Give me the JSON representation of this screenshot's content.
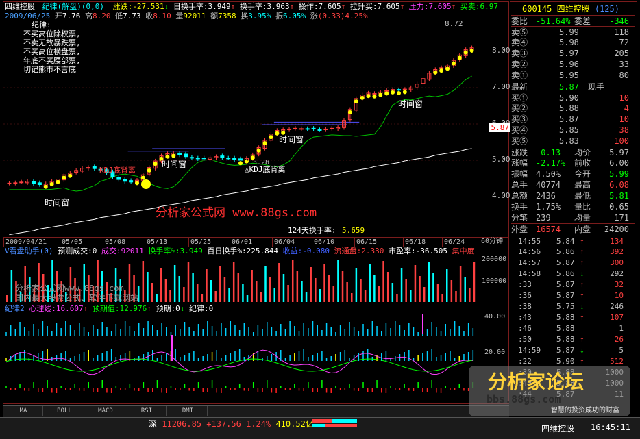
{
  "chart_header": {
    "stock_name": "四维控股",
    "indicator": "纪律(解盘)(0,0)",
    "stats": [
      {
        "label": "涨跌:",
        "value": "-27.531",
        "arrow": "↓",
        "color": "#ffff00"
      },
      {
        "label": "日换手率:",
        "value": "3.949",
        "arrow": "↑",
        "color": "#ffffff"
      },
      {
        "label": "换手率:",
        "value": "3.963",
        "arrow": "↑",
        "color": "#ffffff"
      },
      {
        "label": "操作:",
        "value": "7.605",
        "arrow": "↑",
        "color": "#ffffff"
      },
      {
        "label": "拉升买:",
        "value": "7.605",
        "arrow": "↑",
        "color": "#ffffff"
      },
      {
        "label": "压力:",
        "value": "7.605",
        "arrow": "↑",
        "color": "#ff40ff"
      },
      {
        "label": "买卖:",
        "value": "6.97",
        "arrow": "",
        "color": "#00ff00"
      }
    ],
    "bar_info": {
      "date": "2009/06/25",
      "open_label": "开",
      "open": "7.76",
      "high_label": "高",
      "high": "8.20",
      "low_label": "低",
      "low": "7.73",
      "close_label": "收",
      "close": "8.10",
      "vol_label": "量",
      "vol": "92011",
      "amount_label": "额",
      "amount": "7358",
      "turnover_label": "换",
      "turnover": "3.95%",
      "amplitude_label": "振",
      "amplitude": "6.05%",
      "change_label": "涨",
      "change": "(0.33)4.25%"
    }
  },
  "notes": {
    "lines": [
      "纪律:",
      "不买高位除权票,",
      "不卖无故暴跌票,",
      "不买高位横盘票,",
      "年底不买腰部票,",
      "切记熊市不言底"
    ]
  },
  "annotations": {
    "max_price": "8.72",
    "kdj_low": "3.28",
    "time_windows": [
      "时间窗",
      "时间窗",
      "时间窗",
      "时间窗"
    ],
    "kdj_divergence_left": "KDJ底背离",
    "kdj_divergence_right": "△KDJ底背离",
    "watermark": "分析家公式网 www.88gs.com",
    "turnover_124_label": "124天换手率:",
    "turnover_124_value": "5.659"
  },
  "chart_data": {
    "type": "candlestick",
    "price_axis_ticks": [
      "8.00",
      "7.00",
      "6.00",
      "5.00",
      "4.00"
    ],
    "current_price_tag": "5.87",
    "date_ticks": [
      "2009/04/21",
      "05/05",
      "05/08",
      "05/13",
      "05/25",
      "06/01",
      "06/04",
      "06/10",
      "06/15",
      "06/18",
      "06/24"
    ],
    "closes": [
      4.37,
      4.38,
      4.4,
      4.42,
      4.36,
      4.33,
      4.35,
      4.42,
      4.48,
      4.6,
      4.65,
      4.72,
      4.78,
      4.8,
      4.77,
      4.74,
      4.66,
      4.55,
      4.47,
      4.42,
      4.4,
      4.45,
      4.6,
      4.8,
      4.98,
      5.12,
      5.18,
      5.2,
      5.15,
      5.1,
      5.06,
      5.04,
      5.05,
      5.07,
      5.1,
      5.08,
      5.06,
      5.02,
      5.0,
      5.05,
      5.15,
      5.35,
      5.55,
      5.72,
      5.82,
      5.84,
      5.86,
      5.88,
      5.87,
      5.86,
      5.86,
      5.84,
      5.86,
      5.88,
      5.9,
      6.1,
      6.4,
      6.7,
      6.8,
      6.85,
      6.84,
      6.88,
      6.92,
      6.95,
      6.93,
      6.96,
      7.0,
      7.1,
      7.25,
      7.4,
      7.5,
      7.55,
      7.6,
      7.75,
      7.9,
      8.05,
      8.1
    ],
    "window_label": "60分钟"
  },
  "volume_panel": {
    "title": "V看盘助手(0)",
    "stats": [
      {
        "label": "预测成交:",
        "value": "0",
        "color": "#ffffff"
      },
      {
        "label": "成交:",
        "value": "92011",
        "color": "#ff40ff"
      },
      {
        "label": "换手率%:",
        "value": "3.949",
        "color": "#00ff00"
      },
      {
        "label": "百日换手%:",
        "value": "225.844",
        "color": "#ffffff"
      },
      {
        "label": "收益:",
        "value": "-0.080",
        "color": "#4060ff"
      },
      {
        "label": "流通盘:",
        "value": "2.330",
        "color": "#ff4040"
      },
      {
        "label": "市盈率:",
        "value": "-36.505",
        "color": "#ffffff"
      },
      {
        "label": "集中度",
        "value": "",
        "color": "#ff4040"
      }
    ],
    "axis_ticks": [
      "200000",
      "100000"
    ],
    "watermark_1": "分析家公式网www.88gs.com",
    "watermark_2": "国内最大股票公式、软件下载网站"
  },
  "indicator_panel": {
    "title": "纪律2",
    "stats": [
      {
        "label": "心理线:",
        "value": "16.607",
        "arrow": "↑",
        "color": "#ff40ff"
      },
      {
        "label": "预期值:",
        "value": "12.976",
        "arrow": "↑",
        "color": "#00ff00"
      },
      {
        "label": "预期:",
        "value": "0",
        "arrow": "↓",
        "color": "#ffffff"
      },
      {
        "label": "纪律:",
        "value": "0",
        "arrow": "",
        "color": "#ffffff"
      }
    ],
    "axis_ticks": [
      "40.00",
      "20.00"
    ]
  },
  "bottom_tabs": [
    "MA",
    "BOLL",
    "MACD",
    "RSI",
    "DMI"
  ],
  "status_bar": {
    "index_name": "深",
    "index_value": "11206.85",
    "index_change": "+137.56",
    "index_pct": "1.24%",
    "index_amount": "410.52亿",
    "stock_name": "四维控股",
    "time": "16:45:11"
  },
  "quote": {
    "code": "600145",
    "name": "四维控股",
    "count": "(125)",
    "ratio_label": "委比",
    "ratio": "-51.64%",
    "diff_label": "委差",
    "diff": "-346",
    "asks": [
      {
        "label": "卖⑤",
        "price": "5.99",
        "vol": "118"
      },
      {
        "label": "卖④",
        "price": "5.98",
        "vol": "72"
      },
      {
        "label": "卖③",
        "price": "5.97",
        "vol": "205"
      },
      {
        "label": "卖②",
        "price": "5.96",
        "vol": "33"
      },
      {
        "label": "卖①",
        "price": "5.95",
        "vol": "80"
      }
    ],
    "last_label": "最新",
    "last": "5.87",
    "hand_label": "现手",
    "bids": [
      {
        "label": "买①",
        "price": "5.90",
        "vol": "10"
      },
      {
        "label": "买②",
        "price": "5.88",
        "vol": "4"
      },
      {
        "label": "买③",
        "price": "5.87",
        "vol": "10"
      },
      {
        "label": "买④",
        "price": "5.85",
        "vol": "38"
      },
      {
        "label": "买⑤",
        "price": "5.83",
        "vol": "100"
      }
    ],
    "stats": [
      {
        "l1": "涨跌",
        "v1": "-0.13",
        "c1": "#00ff00",
        "l2": "均价",
        "v2": "5.97",
        "c2": "#c0c0c0"
      },
      {
        "l1": "涨幅",
        "v1": "-2.17%",
        "c1": "#00ff00",
        "l2": "前收",
        "v2": "6.00",
        "c2": "#c0c0c0"
      },
      {
        "l1": "振幅",
        "v1": "4.50%",
        "c1": "#c0c0c0",
        "l2": "今开",
        "v2": "5.99",
        "c2": "#00ff00"
      },
      {
        "l1": "总手",
        "v1": "40774",
        "c1": "#c0c0c0",
        "l2": "最高",
        "v2": "6.08",
        "c2": "#ff4040"
      },
      {
        "l1": "总额",
        "v1": "2436",
        "c1": "#c0c0c0",
        "l2": "最低",
        "v2": "5.81",
        "c2": "#00ff00"
      },
      {
        "l1": "换手",
        "v1": "1.75%",
        "c1": "#c0c0c0",
        "l2": "量比",
        "v2": "0.65",
        "c2": "#c0c0c0"
      },
      {
        "l1": "分笔",
        "v1": "239",
        "c1": "#c0c0c0",
        "l2": "均量",
        "v2": "171",
        "c2": "#c0c0c0"
      }
    ],
    "outer_label": "外盘",
    "outer": "16574",
    "inner_label": "内盘",
    "inner": "24200",
    "ticks": [
      {
        "time": "14:55",
        "price": "5.84",
        "vol": "134",
        "dir": "↑",
        "vc": "#ff4040"
      },
      {
        "time": "14:56",
        "price": "5.86",
        "vol": "392",
        "dir": "↑",
        "vc": "#ff4040"
      },
      {
        "time": "14:57",
        "price": "5.87",
        "vol": "300",
        "dir": "↑",
        "vc": "#ff4040"
      },
      {
        "time": "14:58",
        "price": "5.86",
        "vol": "292",
        "dir": "↓",
        "vc": "#c0c0c0"
      },
      {
        "time": ":33",
        "price": "5.87",
        "vol": "32",
        "dir": "↑",
        "vc": "#ff4040"
      },
      {
        "time": ":36",
        "price": "5.87",
        "vol": "10",
        "dir": "↑",
        "vc": "#ff4040"
      },
      {
        "time": ":38",
        "price": "5.75",
        "vol": "246",
        "dir": "↓",
        "vc": "#c0c0c0"
      },
      {
        "time": ":43",
        "price": "5.88",
        "vol": "107",
        "dir": "↑",
        "vc": "#ff4040"
      },
      {
        "time": ":46",
        "price": "5.88",
        "vol": "1",
        "dir": "",
        "vc": "#c0c0c0"
      },
      {
        "time": ":50",
        "price": "5.88",
        "vol": "26",
        "dir": "↑",
        "vc": "#ff4040"
      },
      {
        "time": "14:59",
        "price": "5.87",
        "vol": "5",
        "dir": "↓",
        "vc": "#c0c0c0"
      },
      {
        "time": ":22",
        "price": "5.90",
        "vol": "512",
        "dir": "↑",
        "vc": "#ff4040"
      },
      {
        "time": ":30",
        "price": "5.88",
        "vol": "1000",
        "dir": "",
        "vc": "#c0c0c0"
      },
      {
        "time": ":40",
        "price": "5.88",
        "vol": "1000",
        "dir": "",
        "vc": "#c0c0c0"
      },
      {
        "time": ":44",
        "price": "5.87",
        "vol": "11",
        "dir": "",
        "vc": "#c0c0c0"
      }
    ]
  },
  "forum_logo": {
    "text": "分析家论坛",
    "url": "bbs.88gs.com",
    "sub": "智慧的投资成功的财富"
  },
  "colors": {
    "up": "#ff4040",
    "down": "#00ffff",
    "neutral": "#c0c0c0",
    "frame": "#7a1c1c",
    "bg": "#000000"
  }
}
